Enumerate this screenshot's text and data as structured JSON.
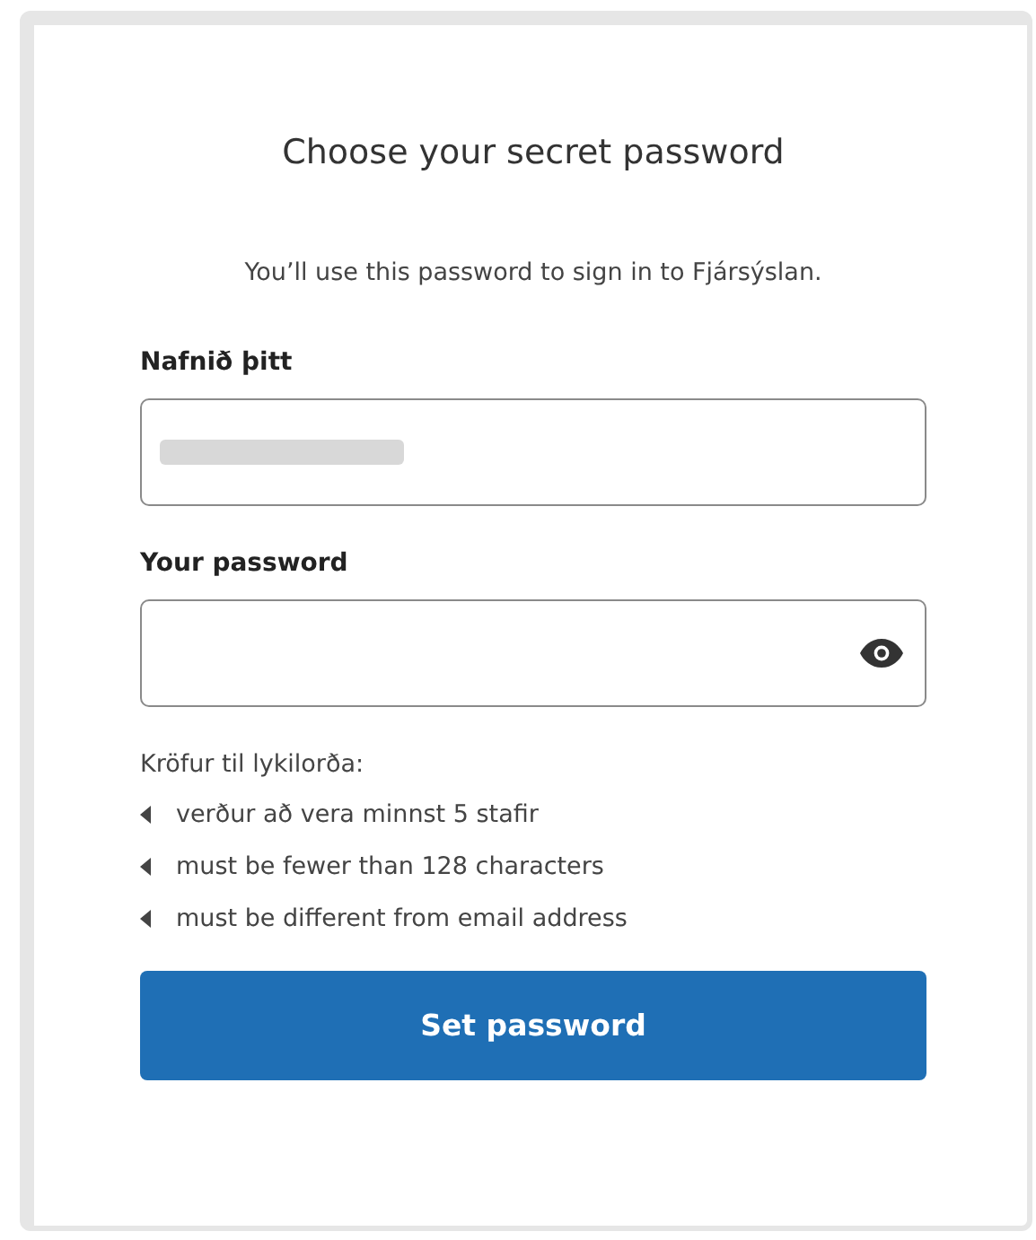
{
  "title": "Choose your secret password",
  "subtitle": "You’ll use this password to sign in to Fjársýslan.",
  "fields": [
    {
      "label": "Nafnið þitt",
      "value_redacted": true
    },
    {
      "label": "Your password",
      "reveal_toggle": true
    }
  ],
  "requirements": {
    "heading": "Kröfur til lykilorða:",
    "items": [
      "verður að vera minnst 5 stafir",
      "must be fewer than 128 characters",
      "must be different from email address"
    ]
  },
  "submit": "Set password"
}
